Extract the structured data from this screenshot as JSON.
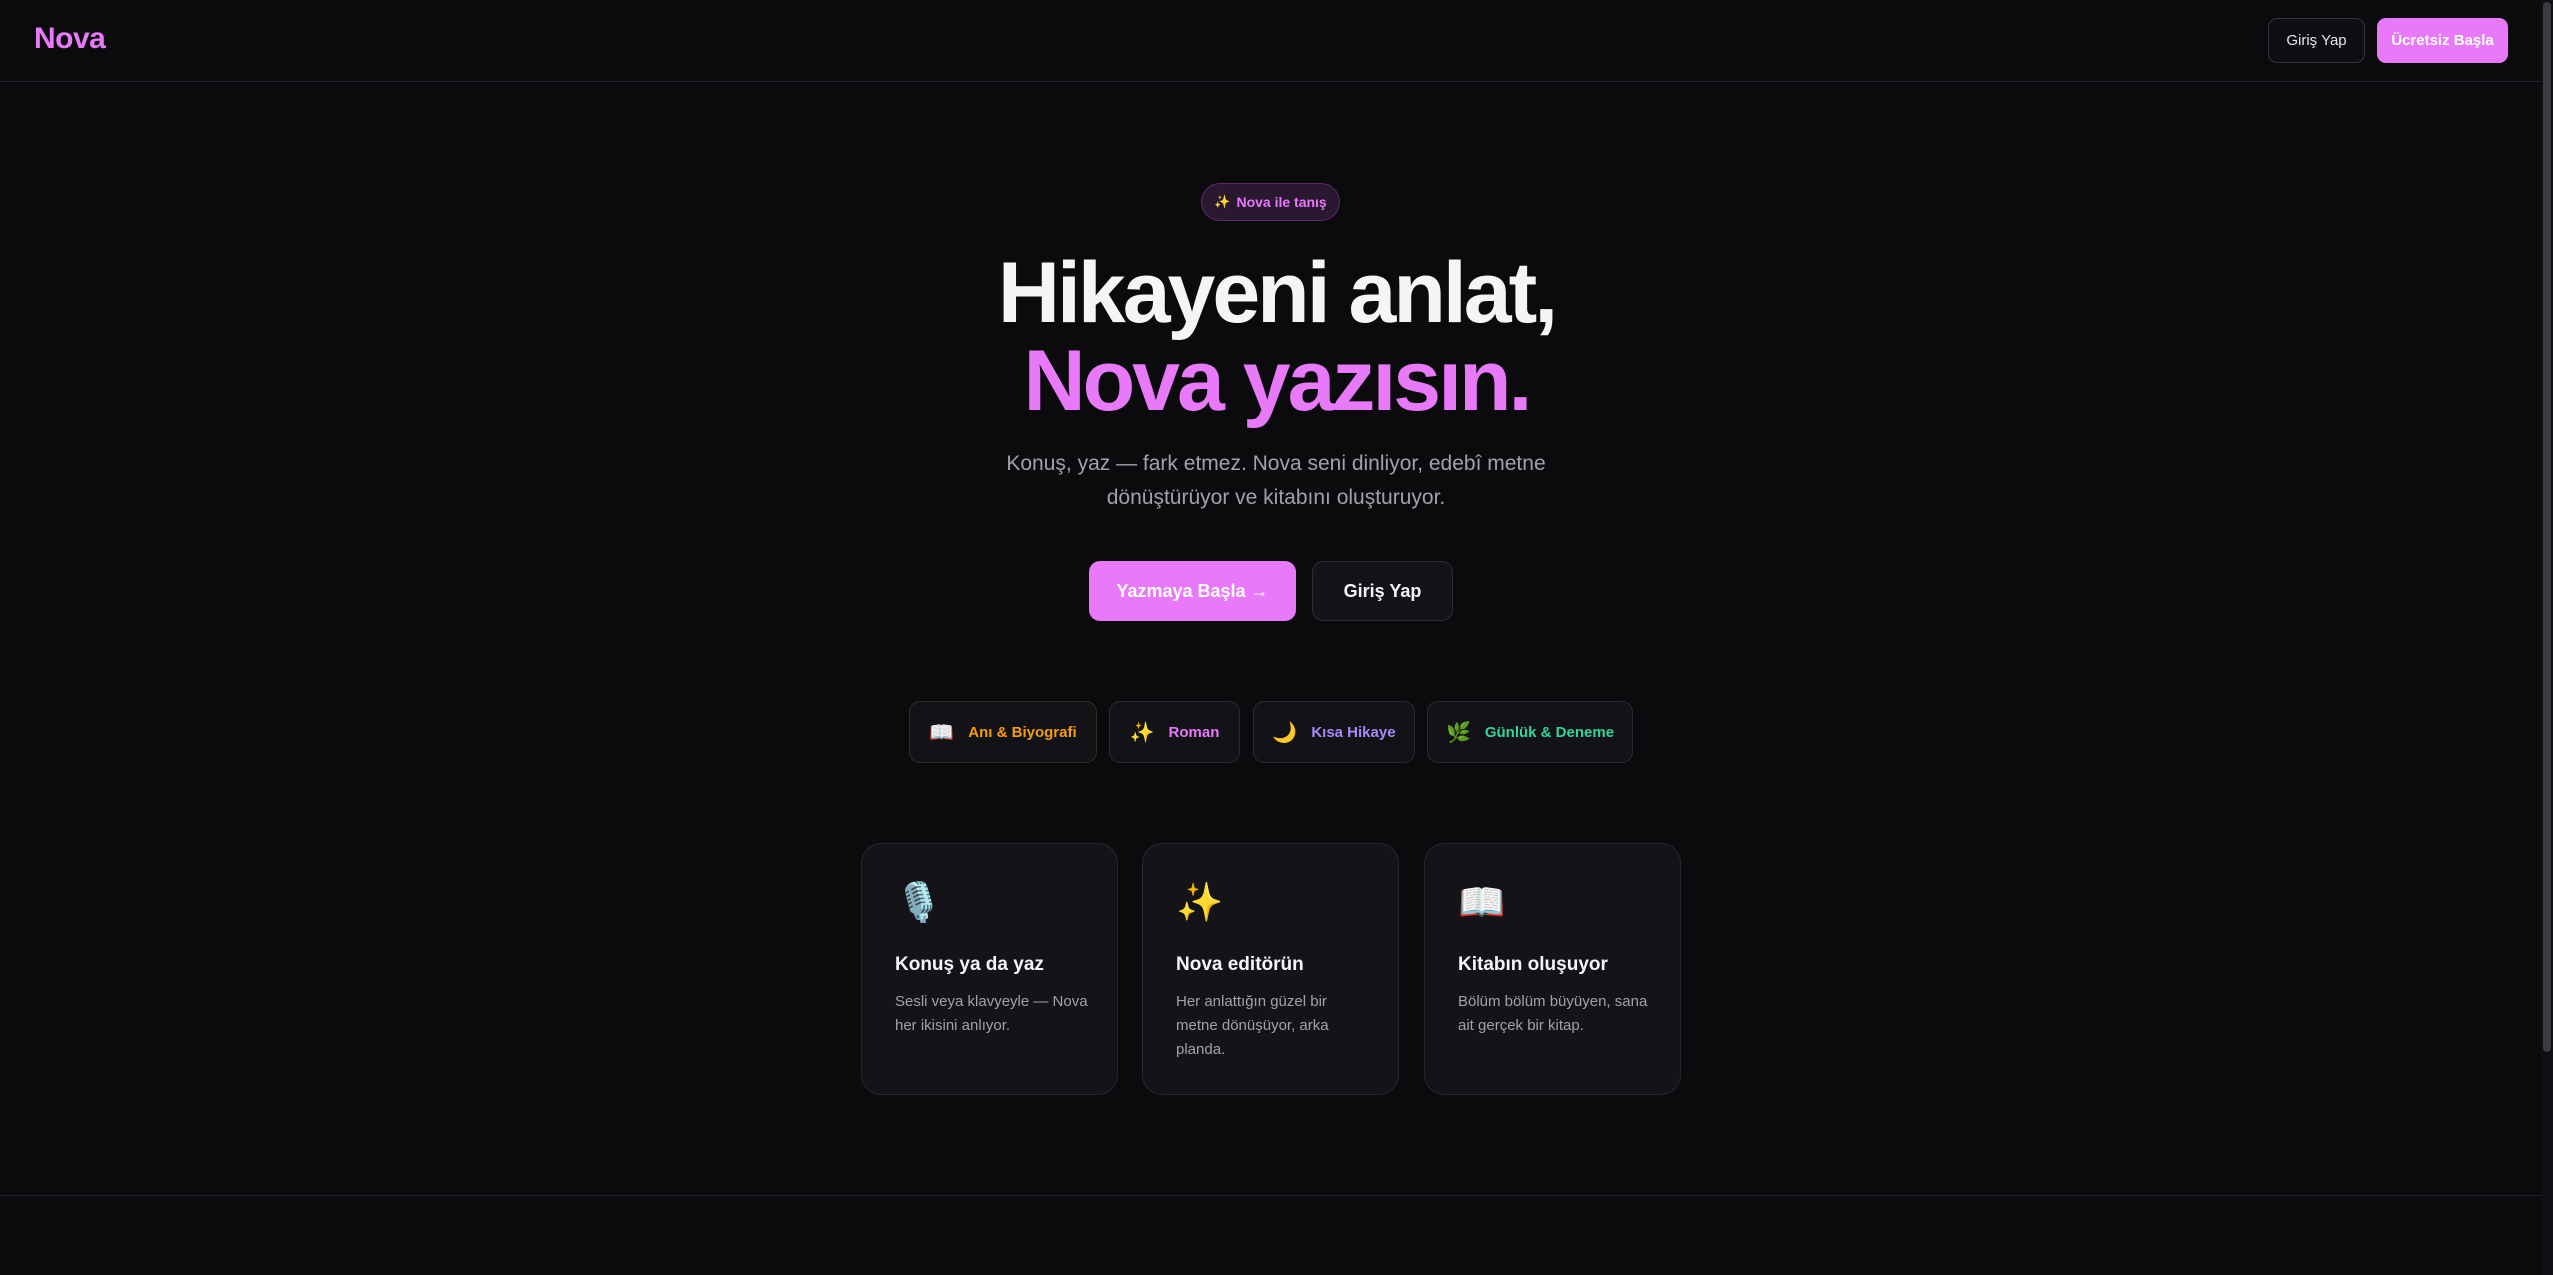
{
  "header": {
    "logo": "Nova",
    "login_label": "Giriş Yap",
    "signup_label": "Ücretsiz Başla"
  },
  "hero": {
    "badge_icon": "sparkles-icon",
    "badge_text": "Nova ile tanış",
    "title_line1": "Hikayeni anlat,",
    "title_line2": "Nova yazısın.",
    "subtitle": "Konuş, yaz — fark etmez. Nova seni dinliyor, edebî metne dönüştürüyor ve kitabını oluşturuyor.",
    "primary_cta": "Yazmaya Başla →",
    "secondary_cta": "Giriş Yap"
  },
  "genres": [
    {
      "icon": "📖",
      "label": "Anı & Biyografi",
      "color": "#f59e0b"
    },
    {
      "icon": "✨",
      "label": "Roman",
      "color": "#e879f9"
    },
    {
      "icon": "🌙",
      "label": "Kısa Hikaye",
      "color": "#a78bfa"
    },
    {
      "icon": "🌿",
      "label": "Günlük & Deneme",
      "color": "#34d399"
    }
  ],
  "features": [
    {
      "icon": "🎙️",
      "title": "Konuş ya da yaz",
      "description": "Sesli veya klavyeyle — Nova her ikisini anlıyor."
    },
    {
      "icon": "✨",
      "title": "Nova editörün",
      "description": "Her anlattığın güzel bir metne dönüşüyor, arka planda."
    },
    {
      "icon": "📖",
      "title": "Kitabın oluşuyor",
      "description": "Bölüm bölüm büyüyen, sana ait gerçek bir kitap."
    }
  ],
  "colors": {
    "accent": "#e879f9",
    "background": "#0b0b0e",
    "muted_text": "#a1a1aa"
  }
}
